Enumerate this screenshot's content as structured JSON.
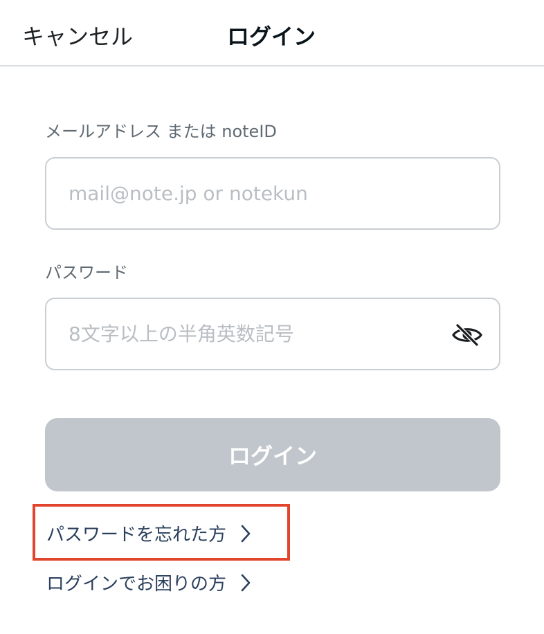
{
  "header": {
    "cancel_label": "キャンセル",
    "title": "ログイン"
  },
  "form": {
    "email_label": "メールアドレス または noteID",
    "email_placeholder": "mail@note.jp or notekun",
    "password_label": "パスワード",
    "password_placeholder": "8文字以上の半角英数記号",
    "login_button": "ログイン"
  },
  "links": {
    "forgot_password": "パスワードを忘れた方",
    "login_help": "ログインでお困りの方"
  },
  "icons": {
    "toggle_visibility": "eye-slash-icon",
    "chevron": "chevron-right-icon"
  },
  "colors": {
    "button_disabled": "#c0c6cb",
    "link": "#2a3f5c",
    "highlight": "#e1452d"
  }
}
